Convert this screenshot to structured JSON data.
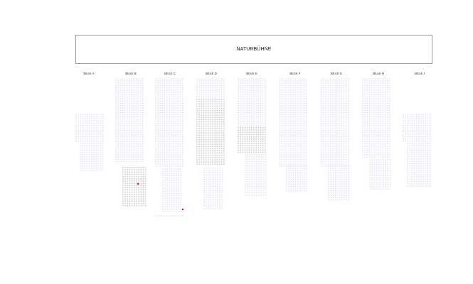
{
  "stage": {
    "label": "NATURBÜHNE"
  },
  "blocks": [
    {
      "id": "A",
      "label": "Block A"
    },
    {
      "id": "B",
      "label": "Block B"
    },
    {
      "id": "C",
      "label": "Block C"
    },
    {
      "id": "D",
      "label": "Block D"
    },
    {
      "id": "E",
      "label": "Block E"
    },
    {
      "id": "F",
      "label": "Block F"
    },
    {
      "id": "G",
      "label": "Block G"
    },
    {
      "id": "H",
      "label": "Block H"
    },
    {
      "id": "I",
      "label": "Block I"
    }
  ],
  "colors": {
    "available": "#e6e4f6",
    "unavailable": "#cfcfcf",
    "selected": "#d9262b",
    "stage_border": "#9a9a9a"
  }
}
